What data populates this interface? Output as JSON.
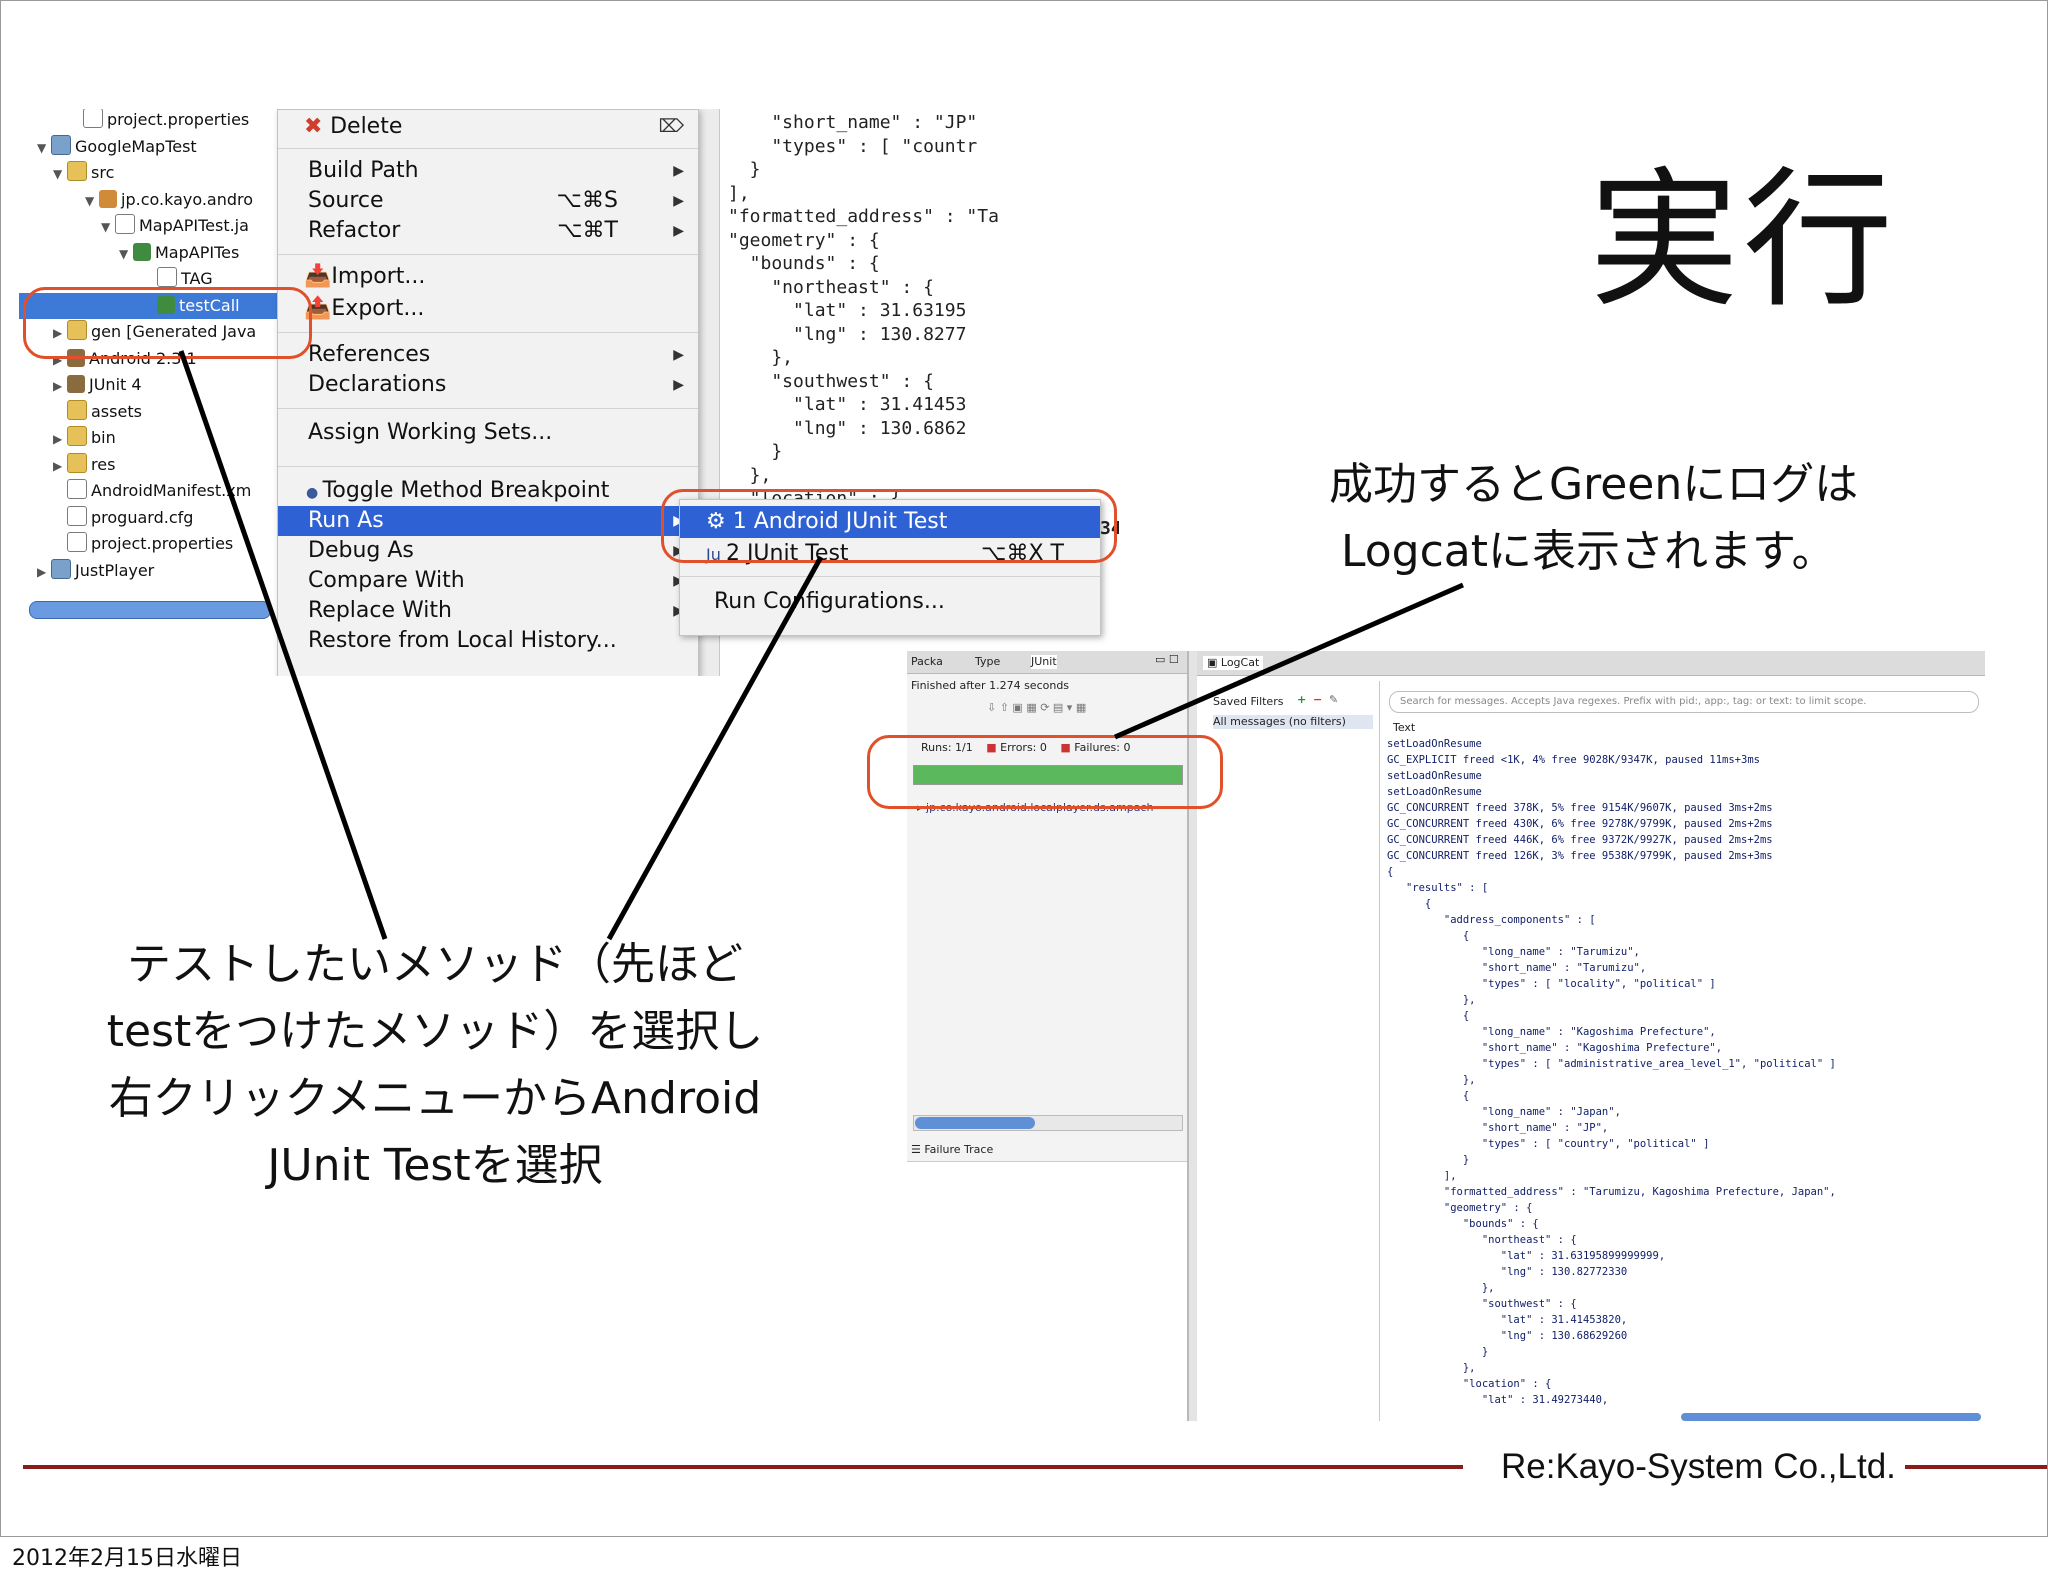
{
  "slide": {
    "title": "実行",
    "note_right": [
      "成功するとGreenにログは",
      "Logcatに表示されます。"
    ],
    "note_left": [
      "テストしたいメソッド（先ほど",
      "testをつけたメソッド）を選択し",
      "右クリックメニューからAndroid",
      "JUnit Testを選択"
    ],
    "brand": "Re:Kayo-System Co.,Ltd.",
    "date": "2012年2月15日水曜日",
    "accent_color": "#e0502a"
  },
  "project_tree": {
    "items": [
      {
        "label": "project.properties",
        "icon": "file-icon"
      },
      {
        "label": "GoogleMapTest",
        "icon": "project-icon"
      },
      {
        "label": "src",
        "icon": "folder-icon"
      },
      {
        "label": "jp.co.kayo.andro",
        "icon": "package-icon"
      },
      {
        "label": "MapAPITest.ja",
        "icon": "java-file-icon"
      },
      {
        "label": "MapAPITes",
        "icon": "class-icon"
      },
      {
        "label": "TAG",
        "icon": "field-icon"
      },
      {
        "label": "testCall",
        "icon": "method-icon"
      },
      {
        "label": "gen [Generated Java",
        "icon": "folder-icon"
      },
      {
        "label": "Android 2.3.1",
        "icon": "library-icon"
      },
      {
        "label": "JUnit 4",
        "icon": "library-icon"
      },
      {
        "label": "assets",
        "icon": "folder-icon"
      },
      {
        "label": "bin",
        "icon": "folder-icon"
      },
      {
        "label": "res",
        "icon": "folder-icon"
      },
      {
        "label": "AndroidManifest.xm",
        "icon": "xml-file-icon"
      },
      {
        "label": "proguard.cfg",
        "icon": "file-icon"
      },
      {
        "label": "project.properties",
        "icon": "file-icon"
      },
      {
        "label": "JustPlayer",
        "icon": "project-icon"
      }
    ]
  },
  "context_menu": {
    "delete": "Delete",
    "build_path": "Build Path",
    "source": "Source",
    "source_shortcut": "⌥⌘S",
    "refactor": "Refactor",
    "refactor_shortcut": "⌥⌘T",
    "import": "Import...",
    "export": "Export...",
    "references": "References",
    "declarations": "Declarations",
    "assign_working_sets": "Assign Working Sets...",
    "toggle_breakpoint": "Toggle Method Breakpoint",
    "run_as": "Run As",
    "debug_as": "Debug As",
    "compare_with": "Compare With",
    "replace_with": "Replace With",
    "restore_history": "Restore from Local History..."
  },
  "run_as_submenu": {
    "item1": "1 Android JUnit Test",
    "item2": "2 JUnit Test",
    "item2_shortcut": "⌥⌘X T",
    "run_configurations": "Run Configurations..."
  },
  "editor_code": "    \"short_name\" : \"JP\"\n    \"types\" : [ \"countr\n  }\n],\n\"formatted_address\" : \"Ta\n\"geometry\" : {\n  \"bounds\" : {\n    \"northeast\" : {\n      \"lat\" : 31.63195\n      \"lng\" : 130.8277\n    },\n    \"southwest\" : {\n      \"lat\" : 31.41453\n      \"lng\" : 130.6862\n    }\n  },\n  \"location\" : {",
  "editor_extra": "344",
  "junit_panel": {
    "tabs": [
      "Packa",
      "Type",
      "JUnit"
    ],
    "finished": "Finished after 1.274 seconds",
    "runs_label": "Runs:",
    "runs_value": "1/1",
    "errors_label": "Errors:",
    "errors_value": "0",
    "failures_label": "Failures:",
    "failures_value": "0",
    "progress_fraction": 1.0,
    "progress_color": "#5cb85c",
    "test_item": "jp.co.kayo.android.localplayer.ds.ampach",
    "failure_trace": "Failure Trace"
  },
  "logcat": {
    "tab": "LogCat",
    "saved_filters": "Saved Filters",
    "all_messages": "All messages (no filters)",
    "search_placeholder": "Search for messages. Accepts Java regexes. Prefix with pid:, app:, tag: or text: to limit scope.",
    "column_text": "Text",
    "lines": "setLoadOnResume\nGC_EXPLICIT freed <1K, 4% free 9028K/9347K, paused 11ms+3ms\nsetLoadOnResume\nsetLoadOnResume\nGC_CONCURRENT freed 378K, 5% free 9154K/9607K, paused 3ms+2ms\nGC_CONCURRENT freed 430K, 6% free 9278K/9799K, paused 2ms+2ms\nGC_CONCURRENT freed 446K, 6% free 9372K/9927K, paused 2ms+2ms\nGC_CONCURRENT freed 126K, 3% free 9538K/9799K, paused 2ms+3ms\n{\n   \"results\" : [\n      {\n         \"address_components\" : [\n            {\n               \"long_name\" : \"Tarumizu\",\n               \"short_name\" : \"Tarumizu\",\n               \"types\" : [ \"locality\", \"political\" ]\n            },\n            {\n               \"long_name\" : \"Kagoshima Prefecture\",\n               \"short_name\" : \"Kagoshima Prefecture\",\n               \"types\" : [ \"administrative_area_level_1\", \"political\" ]\n            },\n            {\n               \"long_name\" : \"Japan\",\n               \"short_name\" : \"JP\",\n               \"types\" : [ \"country\", \"political\" ]\n            }\n         ],\n         \"formatted_address\" : \"Tarumizu, Kagoshima Prefecture, Japan\",\n         \"geometry\" : {\n            \"bounds\" : {\n               \"northeast\" : {\n                  \"lat\" : 31.63195899999999,\n                  \"lng\" : 130.82772330\n               },\n               \"southwest\" : {\n                  \"lat\" : 31.41453820,\n                  \"lng\" : 130.68629260\n               }\n            },\n            \"location\" : {\n               \"lat\" : 31.49273440,"
  }
}
